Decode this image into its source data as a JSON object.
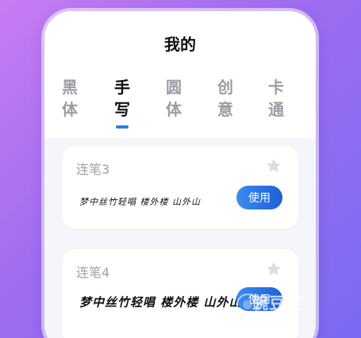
{
  "header": {
    "title": "我的"
  },
  "tabs": [
    {
      "label": "黑体",
      "active": false
    },
    {
      "label": "手写",
      "active": true
    },
    {
      "label": "圆体",
      "active": false
    },
    {
      "label": "创意",
      "active": false
    },
    {
      "label": "卡通",
      "active": false
    }
  ],
  "fonts": [
    {
      "name": "连笔3",
      "sample": "梦中丝竹轻唱 楼外楼 山外山",
      "use_label": "使用",
      "starred": false
    },
    {
      "name": "连笔4",
      "sample": "梦中丝竹轻唱 楼外楼 山外山",
      "use_label": "使用",
      "starred": false
    }
  ],
  "watermark": {
    "text": "豌豆荚"
  },
  "colors": {
    "accent": "#2a7ce8",
    "button_start": "#3a8cf0",
    "button_end": "#1f5fd6",
    "muted_text": "#9ea1a6"
  },
  "icons": {
    "star": "star-icon",
    "watermark": "wandoujia-logo-icon"
  }
}
